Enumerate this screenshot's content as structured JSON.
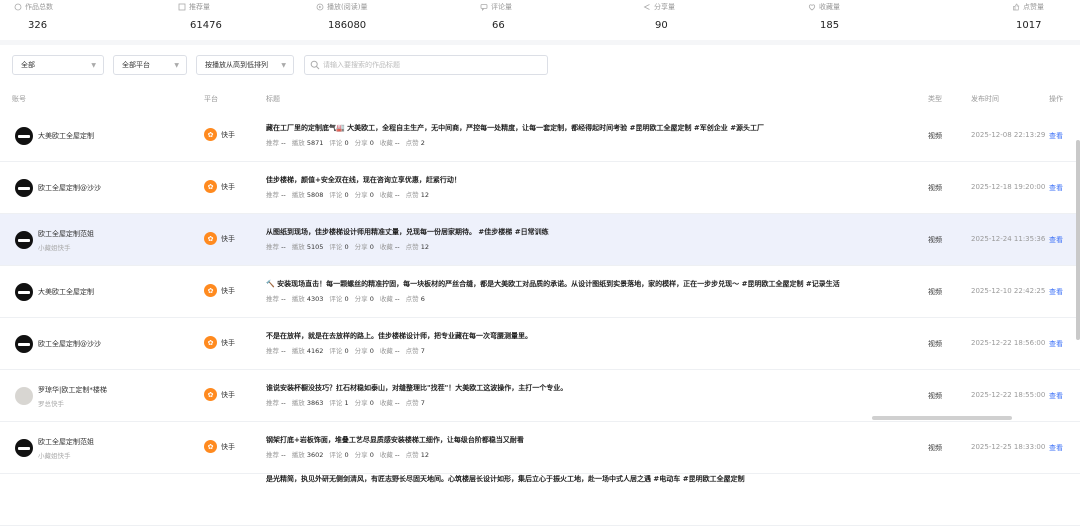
{
  "stats": [
    {
      "label": "作品总数",
      "value": "326",
      "icon": "works-icon"
    },
    {
      "label": "推荐量",
      "value": "61476",
      "icon": "recommend-icon"
    },
    {
      "label": "播放(阅读)量",
      "value": "186080",
      "icon": "play-icon"
    },
    {
      "label": "评论量",
      "value": "66",
      "icon": "comment-icon"
    },
    {
      "label": "分享量",
      "value": "90",
      "icon": "share-icon"
    },
    {
      "label": "收藏量",
      "value": "185",
      "icon": "favorite-icon"
    },
    {
      "label": "点赞量",
      "value": "1017",
      "icon": "like-icon"
    }
  ],
  "filters": {
    "scope": "全部",
    "platform": "全部平台",
    "sort": "按播放从高到低排列",
    "search_placeholder": "请输入要搜索的作品标题"
  },
  "columns": {
    "account": "账号",
    "platform": "平台",
    "title": "标题",
    "type": "类型",
    "time": "发布时间",
    "action": "操作"
  },
  "metric_labels": {
    "recommend": "推荐",
    "play": "播放",
    "comment": "评论",
    "share": "分享",
    "favorite": "收藏",
    "like": "点赞"
  },
  "rows": [
    {
      "account": "大美欧工全屋定制",
      "sub": "",
      "platform": "快手",
      "title": "藏在工厂里的定制底气🏭 大美欧工，全程自主生产，无中间商，严控每一处精度，让每一套定制，都经得起时间考验 #昆明欧工全屋定制 #军创企业 #源头工厂",
      "recommend": "--",
      "play": "5871",
      "comment": "0",
      "share": "0",
      "favorite": "--",
      "like": "2",
      "type": "视频",
      "time": "2025-12-08 22:13:29",
      "action": "查看",
      "avatar": "dark"
    },
    {
      "account": "欧工全屋定制@沙沙",
      "sub": "",
      "platform": "快手",
      "title": "佳步楼梯，颜值+安全双在线，现在咨询立享优惠，赶紧行动！",
      "recommend": "--",
      "play": "5808",
      "comment": "0",
      "share": "0",
      "favorite": "--",
      "like": "12",
      "type": "视频",
      "time": "2025-12-18 19:20:00",
      "action": "查看",
      "avatar": "dark"
    },
    {
      "account": "欧工全屋定制范姐",
      "sub": "小藏姐快手",
      "platform": "快手",
      "title": "从图纸到现场，佳步楼梯设计师用精准丈量，兑现每一份居家期待。 #佳步楼梯 #日常训练",
      "recommend": "--",
      "play": "5105",
      "comment": "0",
      "share": "0",
      "favorite": "--",
      "like": "12",
      "type": "视频",
      "time": "2025-12-24 11:35:36",
      "action": "查看",
      "avatar": "dark"
    },
    {
      "account": "大美欧工全屋定制",
      "sub": "",
      "platform": "快手",
      "title": "🔨 安装现场直击！每一颗螺丝的精准拧固，每一块板材的严丝合缝，都是大美欧工对品质的承诺。从设计图纸到实景落地，家的模样，正在一步步兑现～ #昆明欧工全屋定制 #记录生活",
      "recommend": "--",
      "play": "4303",
      "comment": "0",
      "share": "0",
      "favorite": "--",
      "like": "6",
      "type": "视频",
      "time": "2025-12-10 22:42:25",
      "action": "查看",
      "avatar": "dark"
    },
    {
      "account": "欧工全屋定制@沙沙",
      "sub": "",
      "platform": "快手",
      "title": "不是在放样，就是在去放样的路上。佳步楼梯设计师，把专业藏在每一次弯腰测量里。",
      "recommend": "--",
      "play": "4162",
      "comment": "0",
      "share": "0",
      "favorite": "--",
      "like": "7",
      "type": "视频",
      "time": "2025-12-22 18:56:00",
      "action": "查看",
      "avatar": "dark"
    },
    {
      "account": "罗琼华|欧工定制*楼梯",
      "sub": "罗总快手",
      "platform": "快手",
      "title": "谁说安装杯橱没技巧？扛石材稳如泰山，对缝整理比\"找茬\"！大美欧工这波操作，主打一个专业。",
      "recommend": "--",
      "play": "3863",
      "comment": "1",
      "share": "0",
      "favorite": "--",
      "like": "7",
      "type": "视频",
      "time": "2025-12-22 18:55:00",
      "action": "查看",
      "avatar": "light"
    },
    {
      "account": "欧工全屋定制范姐",
      "sub": "小藏姐快手",
      "platform": "快手",
      "title": "钢架打底+岩板饰面，堆叠工艺尽显质感安装楼梯工细作，让每级台阶都稳当又耐看",
      "recommend": "--",
      "play": "3602",
      "comment": "0",
      "share": "0",
      "favorite": "--",
      "like": "12",
      "type": "视频",
      "time": "2025-12-25 18:33:00",
      "action": "查看",
      "avatar": "dark"
    },
    {
      "account": "",
      "sub": "",
      "platform": "",
      "title": "是光精简，执见外研无侧剑清风，有匠志野长尽固天地间。心筑楼层长设计如形，集后立心于振火工地，赴一场中式人居之遇 #电动车 #昆明欧工全屋定制",
      "recommend": "",
      "play": "",
      "comment": "",
      "share": "",
      "favorite": "",
      "like": "",
      "type": "",
      "time": "",
      "action": "",
      "avatar": "none"
    }
  ]
}
